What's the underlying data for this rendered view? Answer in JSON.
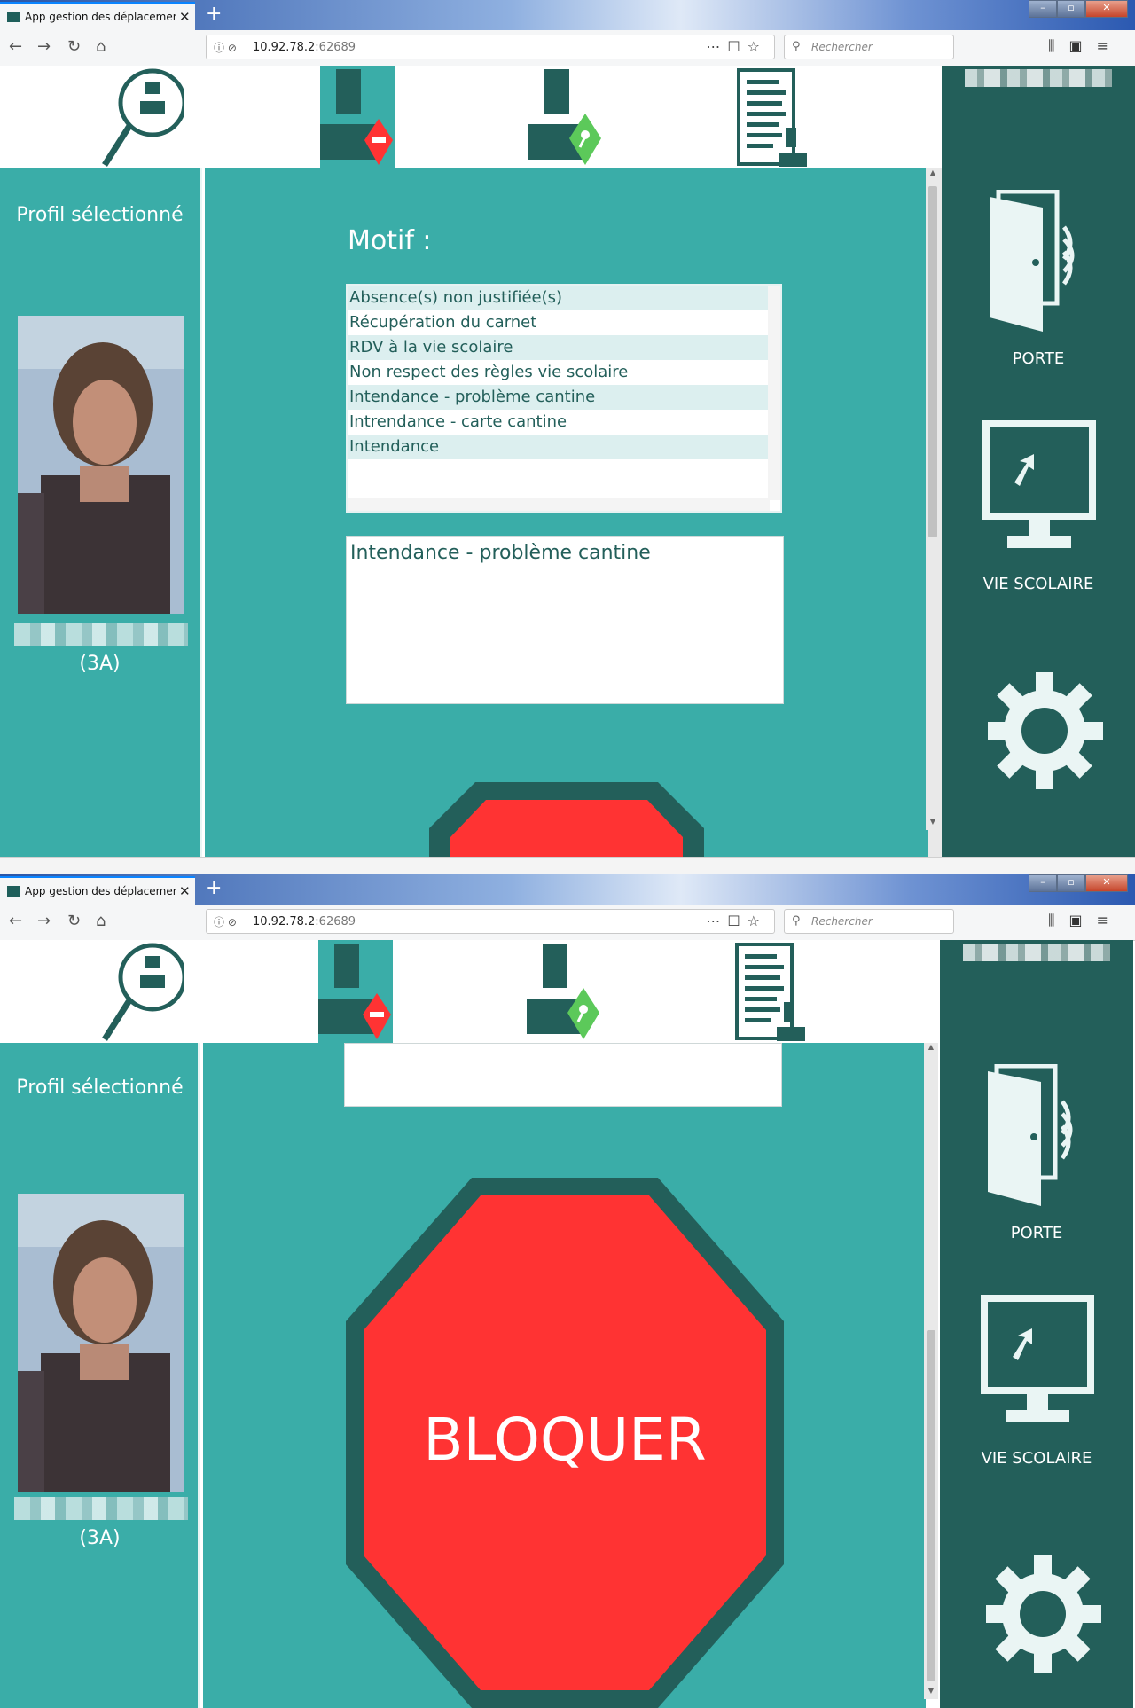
{
  "browser": {
    "tab_title": "App gestion des déplacements",
    "url_host": "10.92.78.2",
    "url_port": ":62689",
    "search_placeholder": "Rechercher"
  },
  "profile": {
    "title": "Profil sélectionné",
    "class": "(3A)"
  },
  "motif": {
    "label": "Motif :",
    "options": [
      "Absence(s) non justifiée(s)",
      "Récupération du carnet",
      "RDV à la vie scolaire",
      "Non respect des règles vie scolaire",
      "Intendance - problème cantine",
      "Intrendance - carte cantine",
      "Intendance"
    ],
    "selected_text": "Intendance - problème cantine"
  },
  "sidebar": {
    "door_label": "PORTE",
    "vie_scolaire_label": "VIE SCOLAIRE"
  },
  "block_button": {
    "label": "BLOQUER"
  },
  "colors": {
    "teal": "#3aada8",
    "dark_teal": "#235f5a",
    "red": "#ff3333",
    "green": "#4cc95a"
  },
  "icons": [
    "search-person-icon",
    "block-exit-icon",
    "allow-exit-icon",
    "log-list-icon",
    "door-icon",
    "monitor-icon",
    "gear-icon",
    "stop-sign-icon"
  ]
}
